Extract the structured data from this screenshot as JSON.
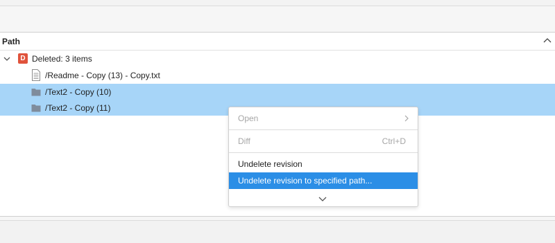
{
  "header": {
    "column_title": "Path"
  },
  "tree": {
    "group": {
      "badge": "D",
      "label": "Deleted: 3 items"
    },
    "items": [
      {
        "path": "/Readme - Copy (13) - Copy.txt",
        "icon": "file-icon",
        "selected": false
      },
      {
        "path": "/Text2 - Copy (10)",
        "icon": "folder-icon",
        "selected": true
      },
      {
        "path": "/Text2 - Copy (11)",
        "icon": "folder-icon",
        "selected": true
      }
    ]
  },
  "context_menu": {
    "items": [
      {
        "label": "Open",
        "enabled": false,
        "submenu": true
      },
      {
        "label": "Diff",
        "shortcut": "Ctrl+D",
        "enabled": false
      },
      {
        "label": "Undelete revision",
        "enabled": true
      },
      {
        "label": "Undelete revision to specified path...",
        "enabled": true,
        "highlighted": true
      }
    ]
  },
  "colors": {
    "selection": "#a7d5f8",
    "menu_highlight": "#2b8ee6",
    "deleted_badge": "#e0533c",
    "folder": "#7f8c9c"
  }
}
